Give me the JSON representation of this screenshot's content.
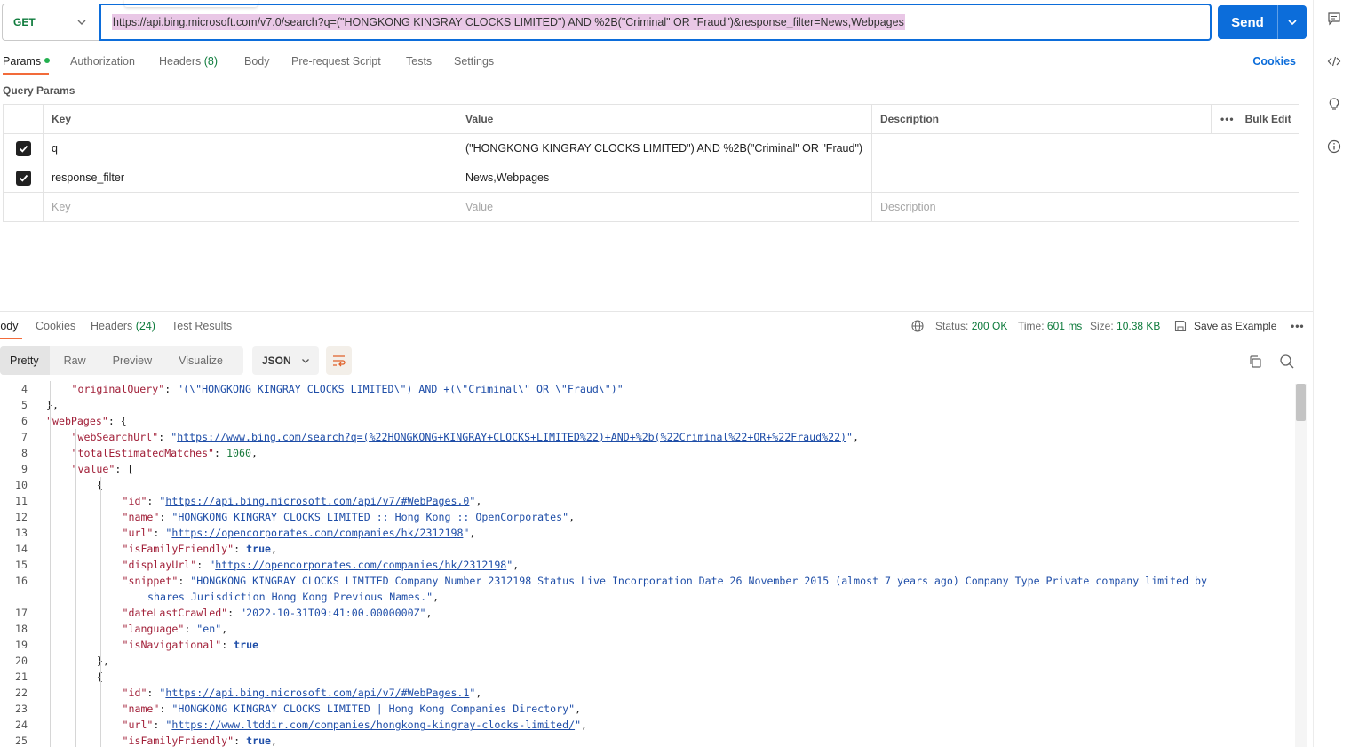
{
  "request": {
    "method": "GET",
    "url": "https://api.bing.microsoft.com/v7.0/search?q=(\"HONGKONG KINGRAY CLOCKS LIMITED\") AND %2B(\"Criminal\" OR \"Fraud\")&response_filter=News,Webpages",
    "send_label": "Send"
  },
  "request_tabs": {
    "params": "Params",
    "authorization": "Authorization",
    "headers": "Headers",
    "headers_count": "(8)",
    "body": "Body",
    "prerequest": "Pre-request Script",
    "tests": "Tests",
    "settings": "Settings",
    "cookies": "Cookies"
  },
  "query_params": {
    "title": "Query Params",
    "headers": {
      "key": "Key",
      "value": "Value",
      "description": "Description",
      "bulk_edit": "Bulk Edit"
    },
    "rows": [
      {
        "key": "q",
        "value": "(\"HONGKONG KINGRAY CLOCKS LIMITED\") AND %2B(\"Criminal\" OR \"Fraud\")",
        "description": ""
      },
      {
        "key": "response_filter",
        "value": "News,Webpages",
        "description": ""
      }
    ],
    "placeholder": {
      "key": "Key",
      "value": "Value",
      "description": "Description"
    }
  },
  "response_tabs": {
    "body": "Body",
    "cookies": "Cookies",
    "headers": "Headers",
    "headers_count": "(24)",
    "test_results": "Test Results"
  },
  "response_meta": {
    "status_label": "Status:",
    "status_value": "200 OK",
    "time_label": "Time:",
    "time_value": "601 ms",
    "size_label": "Size:",
    "size_value": "10.38 KB",
    "save_example": "Save as Example"
  },
  "view_modes": [
    "Pretty",
    "Raw",
    "Preview",
    "Visualize"
  ],
  "format": "JSON",
  "colors": {
    "accent": "#0c6dda",
    "tab_underline": "#f26b3a",
    "ok_green": "#0e7b3c",
    "url_highlight": "#e9c7e6"
  },
  "code_lines": [
    {
      "n": "4",
      "indent": 2,
      "tokens": [
        [
          "k",
          "\"originalQuery\""
        ],
        [
          "p",
          ": "
        ],
        [
          "s",
          "\"(\\\"HONGKONG KINGRAY CLOCKS LIMITED\\\") AND +(\\\"Criminal\\\" OR \\\"Fraud\\\")\""
        ]
      ]
    },
    {
      "n": "5",
      "indent": 1,
      "tokens": [
        [
          "p",
          "},"
        ]
      ]
    },
    {
      "n": "6",
      "indent": 1,
      "tokens": [
        [
          "k",
          "\"webPages\""
        ],
        [
          "p",
          ": {"
        ]
      ]
    },
    {
      "n": "7",
      "indent": 2,
      "tokens": [
        [
          "k",
          "\"webSearchUrl\""
        ],
        [
          "p",
          ": "
        ],
        [
          "s",
          "\""
        ],
        [
          "u",
          "https://www.bing.com/search?q=(%22HONGKONG+KINGRAY+CLOCKS+LIMITED%22)+AND+%2b(%22Criminal%22+OR+%22Fraud%22)"
        ],
        [
          "s",
          "\""
        ],
        [
          "p",
          ","
        ]
      ]
    },
    {
      "n": "8",
      "indent": 2,
      "tokens": [
        [
          "k",
          "\"totalEstimatedMatches\""
        ],
        [
          "p",
          ": "
        ],
        [
          "n",
          "1060"
        ],
        [
          "p",
          ","
        ]
      ]
    },
    {
      "n": "9",
      "indent": 2,
      "tokens": [
        [
          "k",
          "\"value\""
        ],
        [
          "p",
          ": ["
        ]
      ]
    },
    {
      "n": "10",
      "indent": 3,
      "tokens": [
        [
          "p",
          "{"
        ]
      ]
    },
    {
      "n": "11",
      "indent": 4,
      "tokens": [
        [
          "k",
          "\"id\""
        ],
        [
          "p",
          ": "
        ],
        [
          "s",
          "\""
        ],
        [
          "u",
          "https://api.bing.microsoft.com/api/v7/#WebPages.0"
        ],
        [
          "s",
          "\""
        ],
        [
          "p",
          ","
        ]
      ]
    },
    {
      "n": "12",
      "indent": 4,
      "tokens": [
        [
          "k",
          "\"name\""
        ],
        [
          "p",
          ": "
        ],
        [
          "s",
          "\"HONGKONG KINGRAY CLOCKS LIMITED :: Hong Kong :: OpenCorporates\""
        ],
        [
          "p",
          ","
        ]
      ]
    },
    {
      "n": "13",
      "indent": 4,
      "tokens": [
        [
          "k",
          "\"url\""
        ],
        [
          "p",
          ": "
        ],
        [
          "s",
          "\""
        ],
        [
          "u",
          "https://opencorporates.com/companies/hk/2312198"
        ],
        [
          "s",
          "\""
        ],
        [
          "p",
          ","
        ]
      ]
    },
    {
      "n": "14",
      "indent": 4,
      "tokens": [
        [
          "k",
          "\"isFamilyFriendly\""
        ],
        [
          "p",
          ": "
        ],
        [
          "b",
          "true"
        ],
        [
          "p",
          ","
        ]
      ]
    },
    {
      "n": "15",
      "indent": 4,
      "tokens": [
        [
          "k",
          "\"displayUrl\""
        ],
        [
          "p",
          ": "
        ],
        [
          "s",
          "\""
        ],
        [
          "u",
          "https://opencorporates.com/companies/hk/2312198"
        ],
        [
          "s",
          "\""
        ],
        [
          "p",
          ","
        ]
      ]
    },
    {
      "n": "16",
      "indent": 4,
      "tokens": [
        [
          "k",
          "\"snippet\""
        ],
        [
          "p",
          ": "
        ],
        [
          "s",
          "\"HONGKONG KINGRAY CLOCKS LIMITED Company Number 2312198 Status Live Incorporation Date 26 November 2015 (almost 7 years ago) Company Type Private company limited by"
        ]
      ]
    },
    {
      "n": "",
      "indent": 5,
      "tokens": [
        [
          "s",
          "shares Jurisdiction Hong Kong Previous Names.\""
        ],
        [
          "p",
          ","
        ]
      ]
    },
    {
      "n": "17",
      "indent": 4,
      "tokens": [
        [
          "k",
          "\"dateLastCrawled\""
        ],
        [
          "p",
          ": "
        ],
        [
          "s",
          "\"2022-10-31T09:41:00.0000000Z\""
        ],
        [
          "p",
          ","
        ]
      ]
    },
    {
      "n": "18",
      "indent": 4,
      "tokens": [
        [
          "k",
          "\"language\""
        ],
        [
          "p",
          ": "
        ],
        [
          "s",
          "\"en\""
        ],
        [
          "p",
          ","
        ]
      ]
    },
    {
      "n": "19",
      "indent": 4,
      "tokens": [
        [
          "k",
          "\"isNavigational\""
        ],
        [
          "p",
          ": "
        ],
        [
          "b",
          "true"
        ]
      ]
    },
    {
      "n": "20",
      "indent": 3,
      "tokens": [
        [
          "p",
          "},"
        ]
      ]
    },
    {
      "n": "21",
      "indent": 3,
      "tokens": [
        [
          "p",
          "{"
        ]
      ]
    },
    {
      "n": "22",
      "indent": 4,
      "tokens": [
        [
          "k",
          "\"id\""
        ],
        [
          "p",
          ": "
        ],
        [
          "s",
          "\""
        ],
        [
          "u",
          "https://api.bing.microsoft.com/api/v7/#WebPages.1"
        ],
        [
          "s",
          "\""
        ],
        [
          "p",
          ","
        ]
      ]
    },
    {
      "n": "23",
      "indent": 4,
      "tokens": [
        [
          "k",
          "\"name\""
        ],
        [
          "p",
          ": "
        ],
        [
          "s",
          "\"HONGKONG KINGRAY CLOCKS LIMITED | Hong Kong Companies Directory\""
        ],
        [
          "p",
          ","
        ]
      ]
    },
    {
      "n": "24",
      "indent": 4,
      "tokens": [
        [
          "k",
          "\"url\""
        ],
        [
          "p",
          ": "
        ],
        [
          "s",
          "\""
        ],
        [
          "u",
          "https://www.ltddir.com/companies/hongkong-kingray-clocks-limited/"
        ],
        [
          "s",
          "\""
        ],
        [
          "p",
          ","
        ]
      ]
    },
    {
      "n": "25",
      "indent": 4,
      "tokens": [
        [
          "k",
          "\"isFamilyFriendly\""
        ],
        [
          "p",
          ": "
        ],
        [
          "b",
          "true"
        ],
        [
          "p",
          ","
        ]
      ]
    }
  ]
}
